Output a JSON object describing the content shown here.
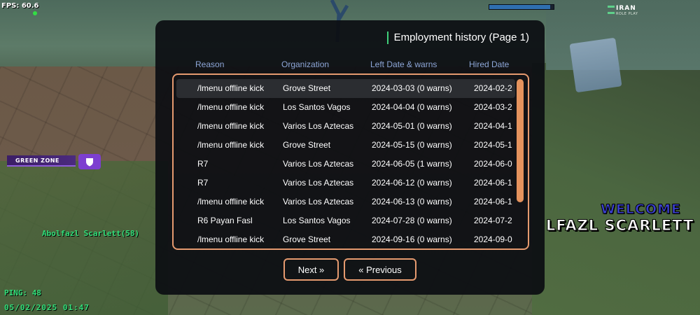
{
  "hud": {
    "fps": "FPS: 60.6",
    "health_fraction": 0.95,
    "logo_main": "IRAN",
    "logo_sub": "ROLE PLAY",
    "zone_label": "GREEN ZONE",
    "player_tag": "Abolfazl Scarlett(58)",
    "ping": "PING: 48",
    "datetime": "05/02/2025 01:47",
    "welcome": "WELCOME",
    "welcome_name": "LFAZL SCARLETT"
  },
  "dialog": {
    "title": "Employment history (Page 1)",
    "columns": [
      "Reason",
      "Organization",
      "Left Date & warns",
      "Hired Date"
    ],
    "rows": [
      {
        "reason": "/lmenu offline kick",
        "organization": "Grove Street",
        "left": "2024-03-03 (0 warns)",
        "hired": "2024-02-2"
      },
      {
        "reason": "/lmenu offline kick",
        "organization": "Los Santos Vagos",
        "left": "2024-04-04 (0 warns)",
        "hired": "2024-03-2"
      },
      {
        "reason": "/lmenu offline kick",
        "organization": "Varios Los Aztecas",
        "left": "2024-05-01 (0 warns)",
        "hired": "2024-04-1"
      },
      {
        "reason": "/lmenu offline kick",
        "organization": "Grove Street",
        "left": "2024-05-15 (0 warns)",
        "hired": "2024-05-1"
      },
      {
        "reason": "R7",
        "organization": "Varios Los Aztecas",
        "left": "2024-06-05 (1 warns)",
        "hired": "2024-06-0"
      },
      {
        "reason": "R7",
        "organization": "Varios Los Aztecas",
        "left": "2024-06-12 (0 warns)",
        "hired": "2024-06-1"
      },
      {
        "reason": "/lmenu offline kick",
        "organization": "Varios Los Aztecas",
        "left": "2024-06-13 (0 warns)",
        "hired": "2024-06-1"
      },
      {
        "reason": "R6 Payan Fasl",
        "organization": "Los Santos Vagos",
        "left": "2024-07-28 (0 warns)",
        "hired": "2024-07-2"
      },
      {
        "reason": "/lmenu offline kick",
        "organization": "Grove Street",
        "left": "2024-09-16 (0 warns)",
        "hired": "2024-09-0"
      }
    ],
    "next_label": "Next »",
    "prev_label": "« Previous"
  },
  "colors": {
    "accent_border": "#e59a6f",
    "scrollbar": "#e5935d",
    "header_text": "#8ea6d8",
    "hud_green": "#33e07a",
    "zone_purple": "#7d3fd0"
  },
  "icons": {
    "zone": "shield-icon",
    "logo": "logo-mark-icon"
  }
}
